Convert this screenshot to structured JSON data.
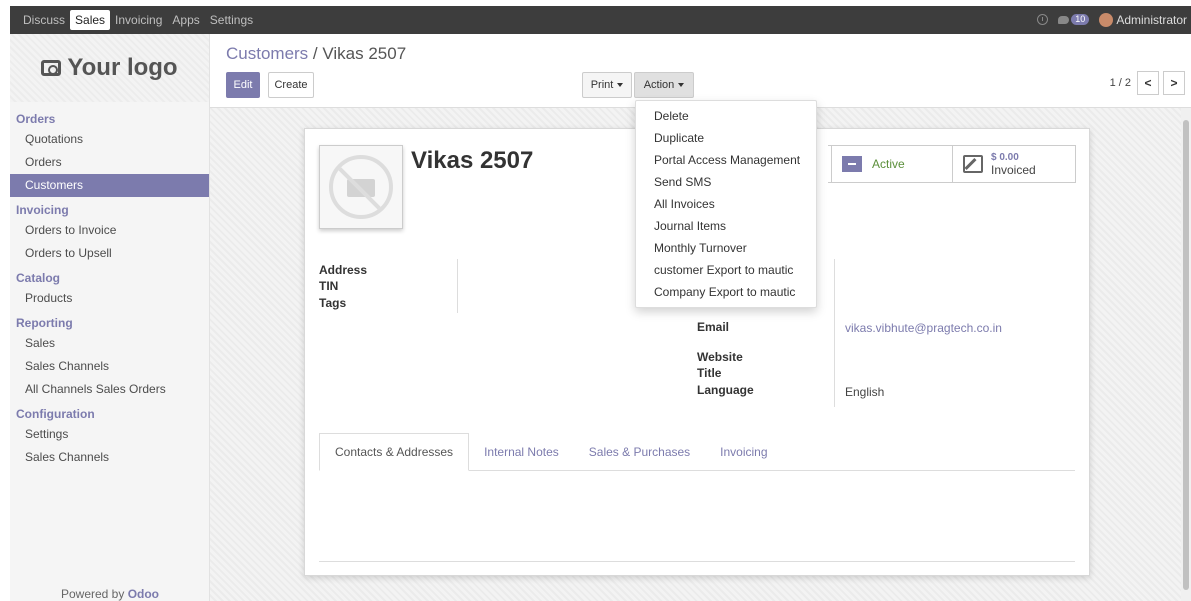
{
  "topbar": {
    "nav": [
      "Discuss",
      "Sales",
      "Invoicing",
      "Apps",
      "Settings"
    ],
    "active": "Sales",
    "chat_count": "10",
    "user": "Administrator"
  },
  "sidebar": {
    "logo": "Your logo",
    "sections": [
      {
        "title": "Orders",
        "items": [
          "Quotations",
          "Orders",
          "Customers"
        ]
      },
      {
        "title": "Invoicing",
        "items": [
          "Orders to Invoice",
          "Orders to Upsell"
        ]
      },
      {
        "title": "Catalog",
        "items": [
          "Products"
        ]
      },
      {
        "title": "Reporting",
        "items": [
          "Sales",
          "Sales Channels",
          "All Channels Sales Orders"
        ]
      },
      {
        "title": "Configuration",
        "items": [
          "Settings",
          "Sales Channels"
        ]
      }
    ],
    "active_item": "Customers",
    "powered_prefix": "Powered by",
    "powered_brand": "Odoo"
  },
  "control": {
    "breadcrumb_parent": "Customers",
    "breadcrumb_sep": " / ",
    "breadcrumb_current": "Vikas 2507",
    "edit": "Edit",
    "create": "Create",
    "print": "Print",
    "action": "Action",
    "pager": "1 / 2",
    "prev": "<",
    "next": ">"
  },
  "action_menu": [
    "Delete",
    "Duplicate",
    "Portal Access Management",
    "Send SMS",
    "All Invoices",
    "Journal Items",
    "Monthly Turnover",
    "customer Export to mautic",
    "Company Export to mautic"
  ],
  "record": {
    "name": "Vikas 2507",
    "stat_active": "Active",
    "stat_amount": "$ 0.00",
    "stat_invoiced": "Invoiced",
    "labels_left": {
      "address": "Address",
      "tin": "TIN",
      "tags": "Tags"
    },
    "labels_right": {
      "email": "Email",
      "website": "Website",
      "title": "Title",
      "language": "Language"
    },
    "email": "vikas.vibhute@pragtech.co.in",
    "language": "English",
    "tabs": [
      "Contacts & Addresses",
      "Internal Notes",
      "Sales & Purchases",
      "Invoicing"
    ]
  },
  "colors": {
    "brand": "#7c7bad",
    "topbar": "#3d3d3d",
    "active_green": "#5b8f3a"
  }
}
